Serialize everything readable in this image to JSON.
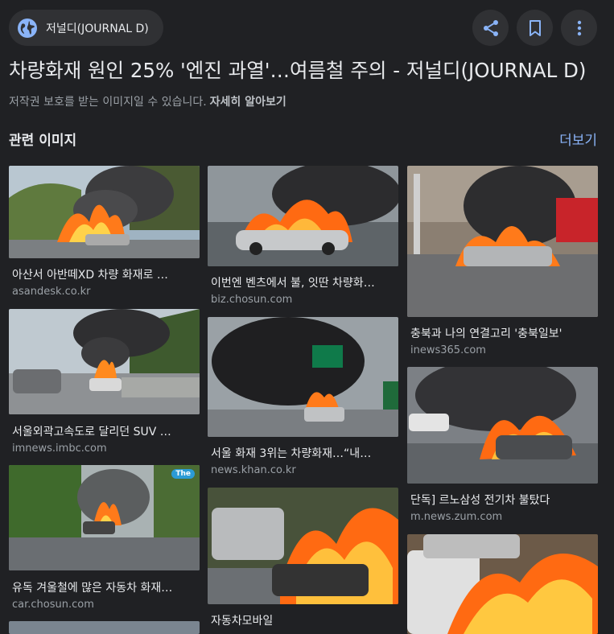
{
  "header": {
    "source_label": "저널디(JOURNAL D)",
    "icons": [
      "globe-icon",
      "share-icon",
      "bookmark-icon",
      "more-vert-icon"
    ]
  },
  "title": "차량화재 원인 25% '엔진 과열'…여름철 주의 - 저널디(JOURNAL D)",
  "copyright": {
    "text": "저작권 보호를 받는 이미지일 수 있습니다.",
    "learn_more": "자세히 알아보기"
  },
  "related": {
    "heading": "관련 이미지",
    "more": "더보기",
    "items": [
      {
        "caption": "아산서 아반떼XD 차량 화재로 …",
        "domain": "asandesk.co.kr"
      },
      {
        "caption": "이번엔 벤츠에서 불, 잇딴 차량화…",
        "domain": "biz.chosun.com"
      },
      {
        "caption": "충북과 나의 연결고리 '충북일보'",
        "domain": "inews365.com"
      },
      {
        "caption": "서울외곽고속도로 달리던 SUV …",
        "domain": "imnews.imbc.com"
      },
      {
        "caption": "서울 화재 3위는 차량화재…“내…",
        "domain": "news.khan.co.kr"
      },
      {
        "caption": "단독] 르노삼성 전기차 불탔다",
        "domain": "m.news.zum.com"
      },
      {
        "caption": "유독 겨울철에 많은 자동차 화재…",
        "domain": "car.chosun.com"
      },
      {
        "caption": "자동차모바일",
        "domain": ""
      },
      {
        "caption": "",
        "domain": ""
      }
    ],
    "watermark": "The"
  },
  "colors": {
    "background": "#202124",
    "chip": "#303134",
    "link": "#8ab4f8",
    "icon": "#8ab4f8",
    "flame": "#ff7a1a"
  }
}
